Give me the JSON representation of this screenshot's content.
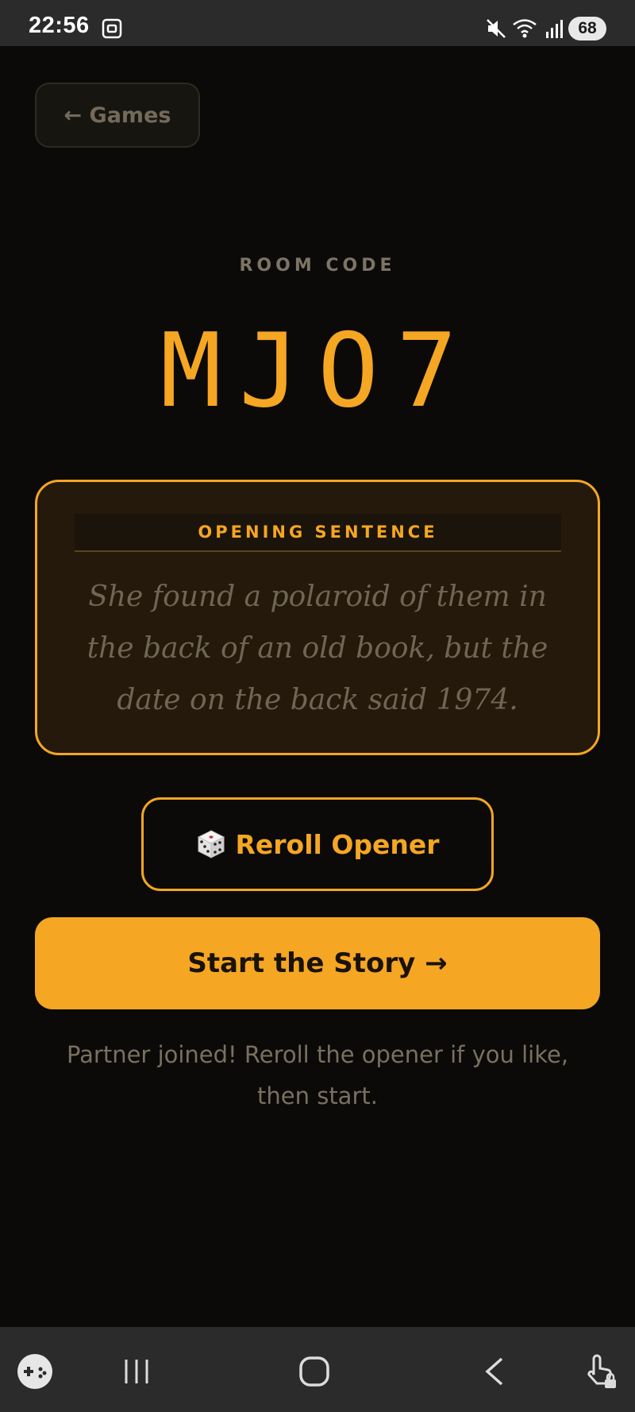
{
  "status_bar": {
    "time": "22:56",
    "battery": "68",
    "icons": [
      "screenshot-icon",
      "mute-icon",
      "wifi-icon",
      "signal-icon"
    ]
  },
  "header": {
    "back_label": "← Games"
  },
  "room": {
    "label": "ROOM CODE",
    "code": "MJO7"
  },
  "opener": {
    "heading": "OPENING SENTENCE",
    "sentence": "She found a polaroid of them in the back of an old book, but the date on the back said 1974."
  },
  "actions": {
    "reroll_label": "Reroll Opener",
    "start_label": "Start the Story →"
  },
  "message": "Partner joined! Reroll the opener if you like, then start.",
  "colors": {
    "accent": "#f5a623",
    "background": "#0b0a09",
    "card_bg": "#24190b"
  },
  "nav_bar": {
    "icons": [
      "game-controller-icon",
      "recent-apps-icon",
      "home-icon",
      "back-icon",
      "touch-lock-icon"
    ]
  }
}
